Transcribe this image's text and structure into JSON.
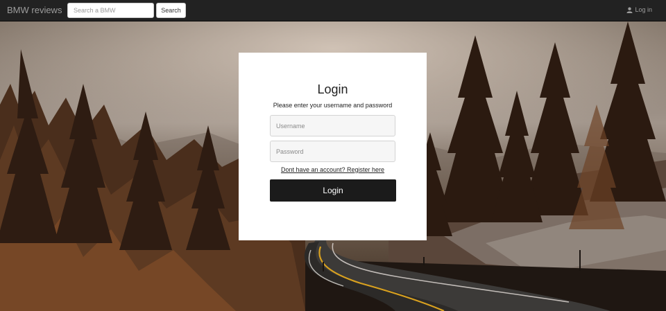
{
  "navbar": {
    "brand": "BMW reviews",
    "search_placeholder": "Search a BMW",
    "search_button": "Search",
    "login_link": "Log in",
    "login_icon": "user-icon"
  },
  "login_form": {
    "title": "Login",
    "subtitle": "Please enter your username and password",
    "username_placeholder": "Username",
    "password_placeholder": "Password",
    "register_link": "Dont have an account? Register here",
    "submit_button": "Login"
  },
  "background": {
    "scene": "forest-road-photo"
  },
  "colors": {
    "navbar_bg": "#222222",
    "navbar_text": "#9d9d9d",
    "button_dark": "#1b1b1b",
    "card_bg": "#ffffff"
  }
}
